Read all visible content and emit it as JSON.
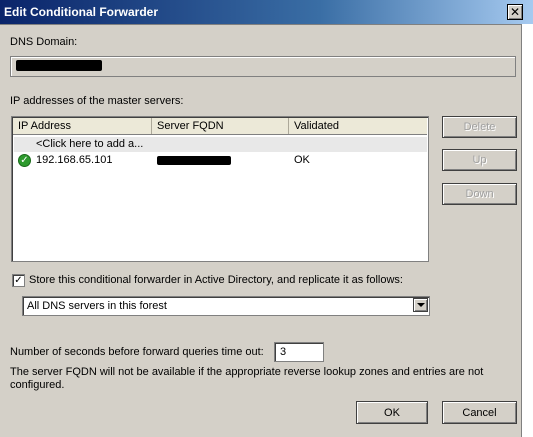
{
  "window": {
    "title": "Edit Conditional Forwarder",
    "close_glyph": "✕"
  },
  "dns_domain": {
    "label": "DNS Domain:",
    "value_redacted": true
  },
  "master_servers": {
    "label": "IP addresses of the master servers:",
    "columns": [
      "IP Address",
      "Server FQDN",
      "Validated"
    ],
    "add_row_text": "<Click here to add a...",
    "rows": [
      {
        "ip": "192.168.65.101",
        "fqdn_redacted": true,
        "validated": "OK",
        "icon": "check-circle-icon"
      }
    ]
  },
  "side_buttons": {
    "delete": "Delete",
    "up": "Up",
    "down": "Down"
  },
  "store_ad": {
    "checked": true,
    "check_glyph": "✓",
    "label": "Store this conditional forwarder in Active Directory, and replicate it as follows:"
  },
  "replication_scope": {
    "selected": "All DNS servers in this forest"
  },
  "timeout": {
    "label": "Number of seconds before forward queries time out:",
    "value": "3"
  },
  "note": "The server FQDN will not be available if the appropriate reverse lookup zones and entries are not configured.",
  "dialog_buttons": {
    "ok": "OK",
    "cancel": "Cancel"
  },
  "colors": {
    "title_bar": "#0a246a",
    "dialog_bg": "#d4d0c8",
    "ok_icon": "#2e9a2e"
  }
}
